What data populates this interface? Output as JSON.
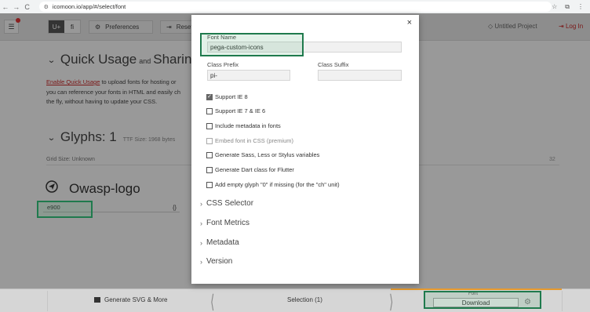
{
  "browser": {
    "back": "←",
    "forward": "→",
    "reload": "C",
    "url": "icomoon.io/app/#/select/font"
  },
  "header": {
    "unicode_tab": "U+",
    "ligature_tab": "fi",
    "preferences": "Preferences",
    "reset": "Reset",
    "project": "Untitled Project",
    "login": "Log In"
  },
  "page": {
    "quick_usage_title": "Quick Usage",
    "quick_usage_and": "and",
    "quick_usage_sharing": "Sharing",
    "quick_usage_link": "Enable Quick Usage",
    "quick_usage_line1": " to upload fonts for hosting or",
    "quick_usage_line2": "you can reference your fonts in HTML and easily ch",
    "quick_usage_line3": "the fly, without having to update your CSS.",
    "glyphs_title": "Glyphs: 1",
    "ttf_size": "TTF Size: 1968 bytes",
    "grid_size": "Grid Size: Unknown",
    "grid_number": "32",
    "set_name": "Owasp-logo",
    "glyph_code": "e900",
    "glyph_value": "{}"
  },
  "modal": {
    "close": "×",
    "font_name_label": "Font Name",
    "font_name_value": "pega-custom-icons",
    "class_prefix_label": "Class Prefix",
    "class_prefix_value": "pi-",
    "class_suffix_label": "Class Suffix",
    "class_suffix_value": "",
    "options": [
      {
        "label": "Support IE 8",
        "checked": true,
        "disabled": false
      },
      {
        "label": "Support IE 7 & IE 6",
        "checked": false,
        "disabled": false
      },
      {
        "label": "Include metadata in fonts",
        "checked": false,
        "disabled": false
      },
      {
        "label": "Embed font in CSS  (premium)",
        "checked": false,
        "disabled": true
      },
      {
        "label": "Generate Sass, Less or Stylus variables",
        "checked": false,
        "disabled": false
      },
      {
        "label": "Generate Dart class for Flutter",
        "checked": false,
        "disabled": false
      },
      {
        "label": "Add empty glyph \"0\" if missing (for the \"ch\" unit)",
        "checked": false,
        "disabled": false
      }
    ],
    "sections": [
      "CSS Selector",
      "Font Metrics",
      "Metadata",
      "Version"
    ]
  },
  "footer": {
    "generate": "Generate SVG & More",
    "selection": "Selection (1)",
    "font_label": "Font",
    "download": "Download"
  },
  "colors": {
    "highlight": "#1f7a4d",
    "accent_red": "#c62828",
    "accent_orange": "#e69a2e"
  }
}
